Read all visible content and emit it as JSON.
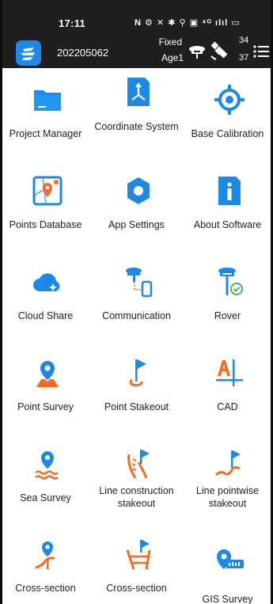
{
  "status_bar": {
    "time": "17:11",
    "icons_text": "N ⚙ ✕ ✱ ⚲ ▣ ⁴ᴳ ılıl ▭"
  },
  "header": {
    "project_id": "202205062",
    "fix_status": "Fixed",
    "age": "Age1",
    "satellites_tracked": "34",
    "satellites_used": "37"
  },
  "tiles": [
    {
      "label": "Project Manager",
      "icon": "folder-icon"
    },
    {
      "label": "Coordinate System",
      "icon": "coordinate-icon"
    },
    {
      "label": "Base Calibration",
      "icon": "target-icon"
    },
    {
      "label": "Points Database",
      "icon": "map-pin-icon"
    },
    {
      "label": "App Settings",
      "icon": "gear-icon"
    },
    {
      "label": "About Software",
      "icon": "info-icon"
    },
    {
      "label": "Cloud Share",
      "icon": "cloud-icon"
    },
    {
      "label": "Communication",
      "icon": "communication-icon"
    },
    {
      "label": "Rover",
      "icon": "rover-icon"
    },
    {
      "label": "Point Survey",
      "icon": "point-survey-icon"
    },
    {
      "label": "Point Stakeout",
      "icon": "stakeout-flag-icon"
    },
    {
      "label": "CAD",
      "icon": "cad-icon"
    },
    {
      "label": "Sea Survey",
      "icon": "sea-survey-icon"
    },
    {
      "label": "Line construction stakeout",
      "icon": "line-construction-icon"
    },
    {
      "label": "Line pointwise stakeout",
      "icon": "line-pointwise-icon"
    },
    {
      "label": "Cross-section",
      "icon": "cross-section-icon"
    },
    {
      "label": "Cross-section",
      "icon": "cross-section-stakeout-icon"
    },
    {
      "label": "GIS Survey",
      "icon": "gis-icon"
    }
  ],
  "colors": {
    "blue": "#1e88e5",
    "orange": "#f26b21",
    "header_bg": "#1f1f1f"
  }
}
